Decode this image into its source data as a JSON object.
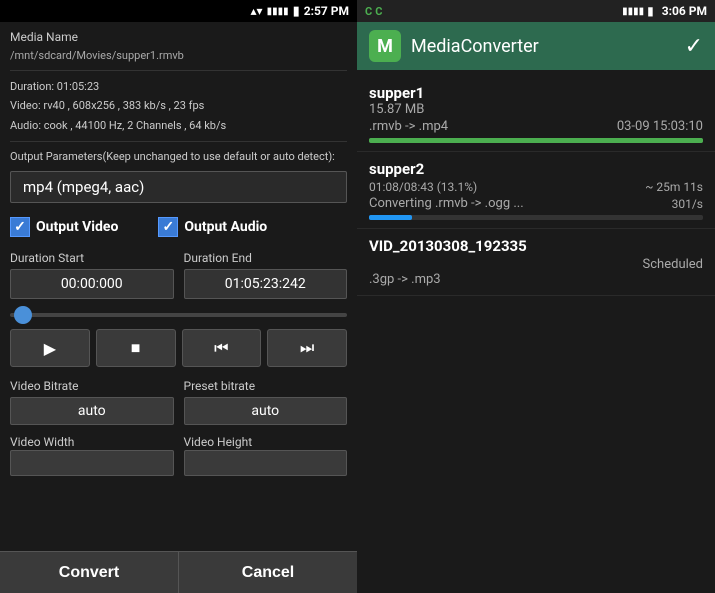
{
  "left": {
    "status_bar": {
      "wifi": "▲▼",
      "signal": "▌▌▌▌",
      "time": "2:57 PM"
    },
    "media_name_label": "Media Name",
    "media_path": "/mnt/sdcard/Movies/supper1.rmvb",
    "duration_label": "Duration: 01:05:23",
    "video_info": "Video: rv40 , 608x256 , 383 kb/s , 23 fps",
    "audio_info": "Audio: cook , 44100 Hz, 2 Channels , 64 kb/s",
    "output_params_label": "Output Parameters(Keep unchanged to use default or auto detect):",
    "format_badge": "mp4 (mpeg4, aac)",
    "output_video_label": "Output Video",
    "output_audio_label": "Output Audio",
    "duration_start_label": "Duration Start",
    "duration_end_label": "Duration End",
    "duration_start_value": "00:00:000",
    "duration_end_value": "01:05:23:242",
    "play_icon": "▶",
    "stop_icon": "■",
    "prev_icon": "⏮",
    "next_icon": "⏭",
    "video_bitrate_label": "Video Bitrate",
    "preset_bitrate_label": "Preset bitrate",
    "video_bitrate_value": "auto",
    "preset_bitrate_value": "auto",
    "video_width_label": "Video Width",
    "video_height_label": "Video Height",
    "convert_button": "Convert",
    "cancel_button": "Cancel"
  },
  "right": {
    "status_bar": {
      "signal": "▌▌▌▌",
      "time": "3:06 PM"
    },
    "app_title": "MediaConverter",
    "items": [
      {
        "name": "supper1",
        "size": "15.87 MB",
        "format": ".rmvb -> .mp4",
        "timestamp": "03-09 15:03:10",
        "progress_percent": 100,
        "progress_type": "green"
      },
      {
        "name": "supper2",
        "size": "",
        "format": "Converting .rmvb -> .ogg ...",
        "timestamp": "~ 25m 11s",
        "progress_text": "01:08/08:43 (13.1%)",
        "progress_percent": 13,
        "progress_type": "blue",
        "speed": "301/s"
      },
      {
        "name": "VID_20130308_192335",
        "size": "",
        "format": ".3gp -> .mp3",
        "timestamp": "",
        "status": "Scheduled",
        "progress_percent": 0,
        "progress_type": "none"
      }
    ]
  }
}
